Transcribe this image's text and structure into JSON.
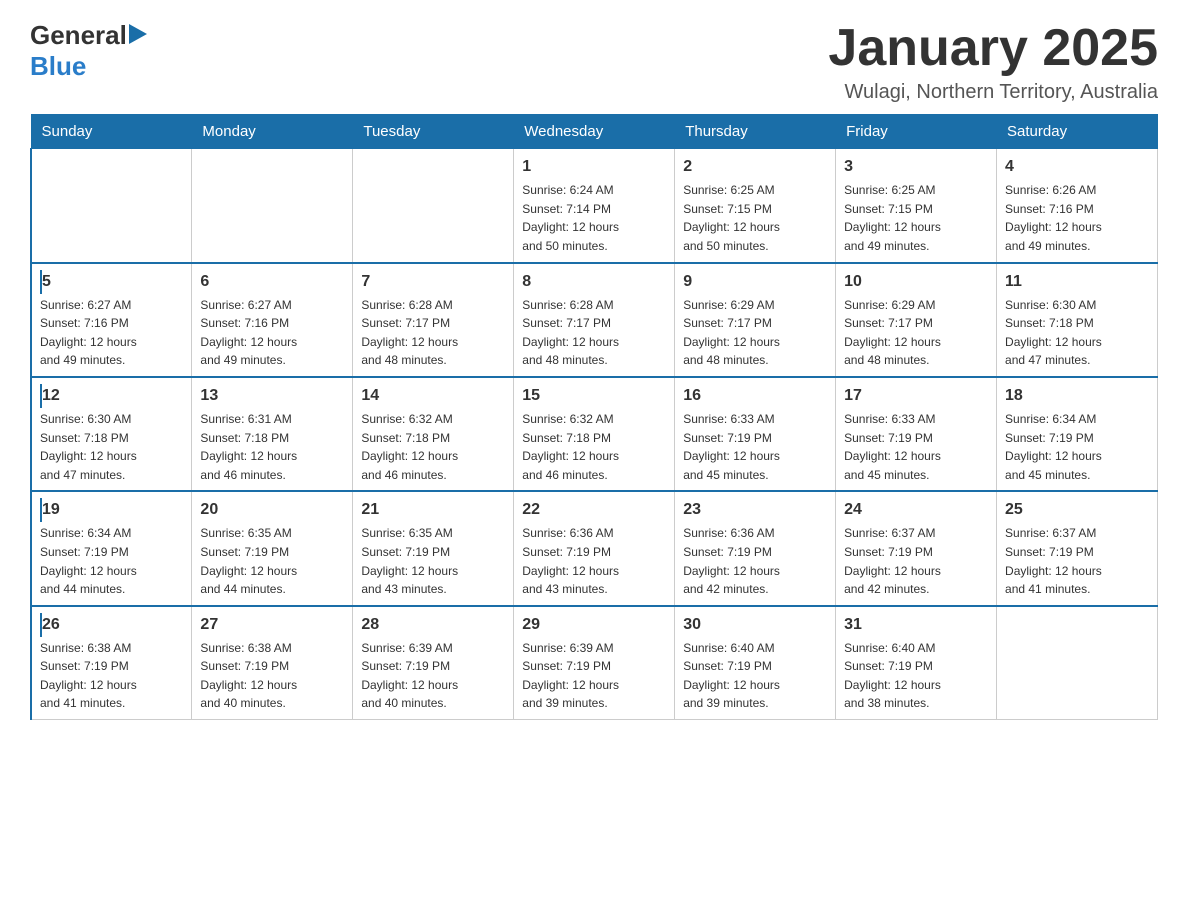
{
  "header": {
    "logo_general": "General",
    "logo_blue": "Blue",
    "month_title": "January 2025",
    "location": "Wulagi, Northern Territory, Australia"
  },
  "weekdays": [
    "Sunday",
    "Monday",
    "Tuesday",
    "Wednesday",
    "Thursday",
    "Friday",
    "Saturday"
  ],
  "weeks": [
    [
      {
        "day": "",
        "info": ""
      },
      {
        "day": "",
        "info": ""
      },
      {
        "day": "",
        "info": ""
      },
      {
        "day": "1",
        "info": "Sunrise: 6:24 AM\nSunset: 7:14 PM\nDaylight: 12 hours\nand 50 minutes."
      },
      {
        "day": "2",
        "info": "Sunrise: 6:25 AM\nSunset: 7:15 PM\nDaylight: 12 hours\nand 50 minutes."
      },
      {
        "day": "3",
        "info": "Sunrise: 6:25 AM\nSunset: 7:15 PM\nDaylight: 12 hours\nand 49 minutes."
      },
      {
        "day": "4",
        "info": "Sunrise: 6:26 AM\nSunset: 7:16 PM\nDaylight: 12 hours\nand 49 minutes."
      }
    ],
    [
      {
        "day": "5",
        "info": "Sunrise: 6:27 AM\nSunset: 7:16 PM\nDaylight: 12 hours\nand 49 minutes."
      },
      {
        "day": "6",
        "info": "Sunrise: 6:27 AM\nSunset: 7:16 PM\nDaylight: 12 hours\nand 49 minutes."
      },
      {
        "day": "7",
        "info": "Sunrise: 6:28 AM\nSunset: 7:17 PM\nDaylight: 12 hours\nand 48 minutes."
      },
      {
        "day": "8",
        "info": "Sunrise: 6:28 AM\nSunset: 7:17 PM\nDaylight: 12 hours\nand 48 minutes."
      },
      {
        "day": "9",
        "info": "Sunrise: 6:29 AM\nSunset: 7:17 PM\nDaylight: 12 hours\nand 48 minutes."
      },
      {
        "day": "10",
        "info": "Sunrise: 6:29 AM\nSunset: 7:17 PM\nDaylight: 12 hours\nand 48 minutes."
      },
      {
        "day": "11",
        "info": "Sunrise: 6:30 AM\nSunset: 7:18 PM\nDaylight: 12 hours\nand 47 minutes."
      }
    ],
    [
      {
        "day": "12",
        "info": "Sunrise: 6:30 AM\nSunset: 7:18 PM\nDaylight: 12 hours\nand 47 minutes."
      },
      {
        "day": "13",
        "info": "Sunrise: 6:31 AM\nSunset: 7:18 PM\nDaylight: 12 hours\nand 46 minutes."
      },
      {
        "day": "14",
        "info": "Sunrise: 6:32 AM\nSunset: 7:18 PM\nDaylight: 12 hours\nand 46 minutes."
      },
      {
        "day": "15",
        "info": "Sunrise: 6:32 AM\nSunset: 7:18 PM\nDaylight: 12 hours\nand 46 minutes."
      },
      {
        "day": "16",
        "info": "Sunrise: 6:33 AM\nSunset: 7:19 PM\nDaylight: 12 hours\nand 45 minutes."
      },
      {
        "day": "17",
        "info": "Sunrise: 6:33 AM\nSunset: 7:19 PM\nDaylight: 12 hours\nand 45 minutes."
      },
      {
        "day": "18",
        "info": "Sunrise: 6:34 AM\nSunset: 7:19 PM\nDaylight: 12 hours\nand 45 minutes."
      }
    ],
    [
      {
        "day": "19",
        "info": "Sunrise: 6:34 AM\nSunset: 7:19 PM\nDaylight: 12 hours\nand 44 minutes."
      },
      {
        "day": "20",
        "info": "Sunrise: 6:35 AM\nSunset: 7:19 PM\nDaylight: 12 hours\nand 44 minutes."
      },
      {
        "day": "21",
        "info": "Sunrise: 6:35 AM\nSunset: 7:19 PM\nDaylight: 12 hours\nand 43 minutes."
      },
      {
        "day": "22",
        "info": "Sunrise: 6:36 AM\nSunset: 7:19 PM\nDaylight: 12 hours\nand 43 minutes."
      },
      {
        "day": "23",
        "info": "Sunrise: 6:36 AM\nSunset: 7:19 PM\nDaylight: 12 hours\nand 42 minutes."
      },
      {
        "day": "24",
        "info": "Sunrise: 6:37 AM\nSunset: 7:19 PM\nDaylight: 12 hours\nand 42 minutes."
      },
      {
        "day": "25",
        "info": "Sunrise: 6:37 AM\nSunset: 7:19 PM\nDaylight: 12 hours\nand 41 minutes."
      }
    ],
    [
      {
        "day": "26",
        "info": "Sunrise: 6:38 AM\nSunset: 7:19 PM\nDaylight: 12 hours\nand 41 minutes."
      },
      {
        "day": "27",
        "info": "Sunrise: 6:38 AM\nSunset: 7:19 PM\nDaylight: 12 hours\nand 40 minutes."
      },
      {
        "day": "28",
        "info": "Sunrise: 6:39 AM\nSunset: 7:19 PM\nDaylight: 12 hours\nand 40 minutes."
      },
      {
        "day": "29",
        "info": "Sunrise: 6:39 AM\nSunset: 7:19 PM\nDaylight: 12 hours\nand 39 minutes."
      },
      {
        "day": "30",
        "info": "Sunrise: 6:40 AM\nSunset: 7:19 PM\nDaylight: 12 hours\nand 39 minutes."
      },
      {
        "day": "31",
        "info": "Sunrise: 6:40 AM\nSunset: 7:19 PM\nDaylight: 12 hours\nand 38 minutes."
      },
      {
        "day": "",
        "info": ""
      }
    ]
  ]
}
